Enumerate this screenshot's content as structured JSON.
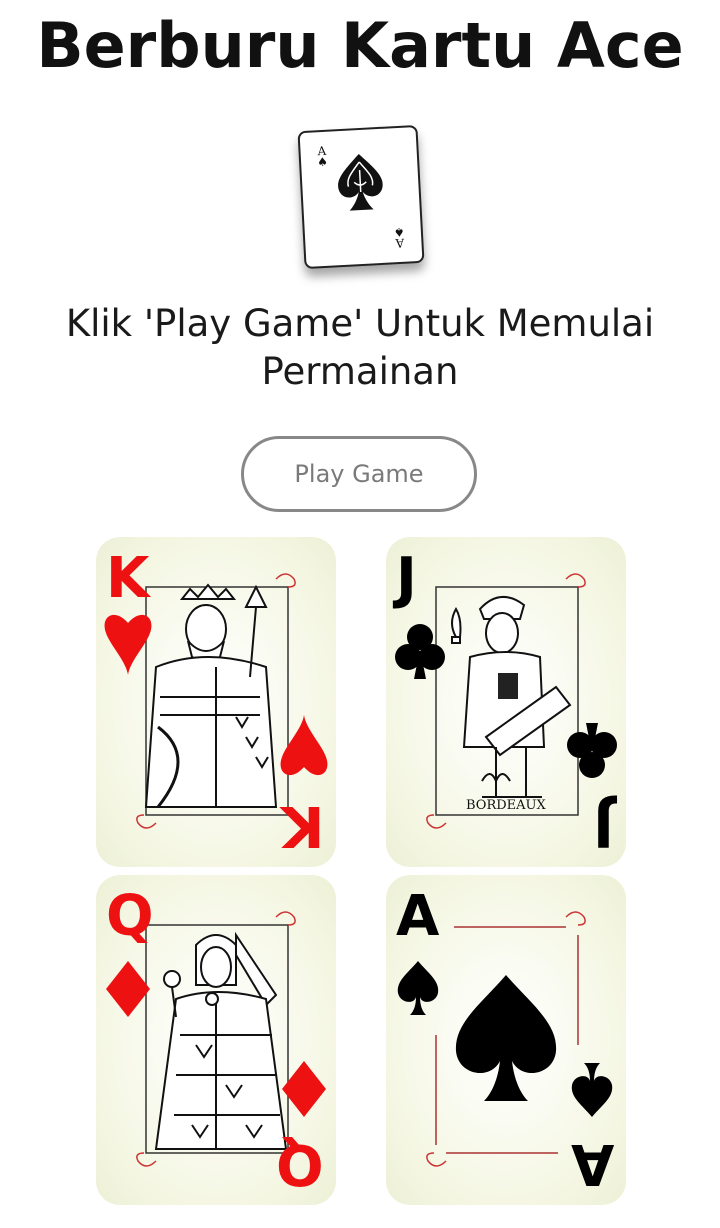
{
  "title": "Berburu Kartu Ace",
  "hero_card": {
    "rank": "A",
    "suit": "spade-icon"
  },
  "instruction": "Klik 'Play Game' Untuk Memulai Permainan",
  "play_button": {
    "label": "Play Game"
  },
  "colors": {
    "red": "#ee1111",
    "black": "#000000",
    "card_bg": "#f5f7e4",
    "button_border": "#888888"
  },
  "cards": [
    {
      "rank": "K",
      "suit": "heart",
      "color": "red"
    },
    {
      "rank": "J",
      "suit": "club",
      "color": "black"
    },
    {
      "rank": "Q",
      "suit": "diamond",
      "color": "red"
    },
    {
      "rank": "A",
      "suit": "spade",
      "color": "black"
    }
  ],
  "card_imprint": "BORDEAUX"
}
